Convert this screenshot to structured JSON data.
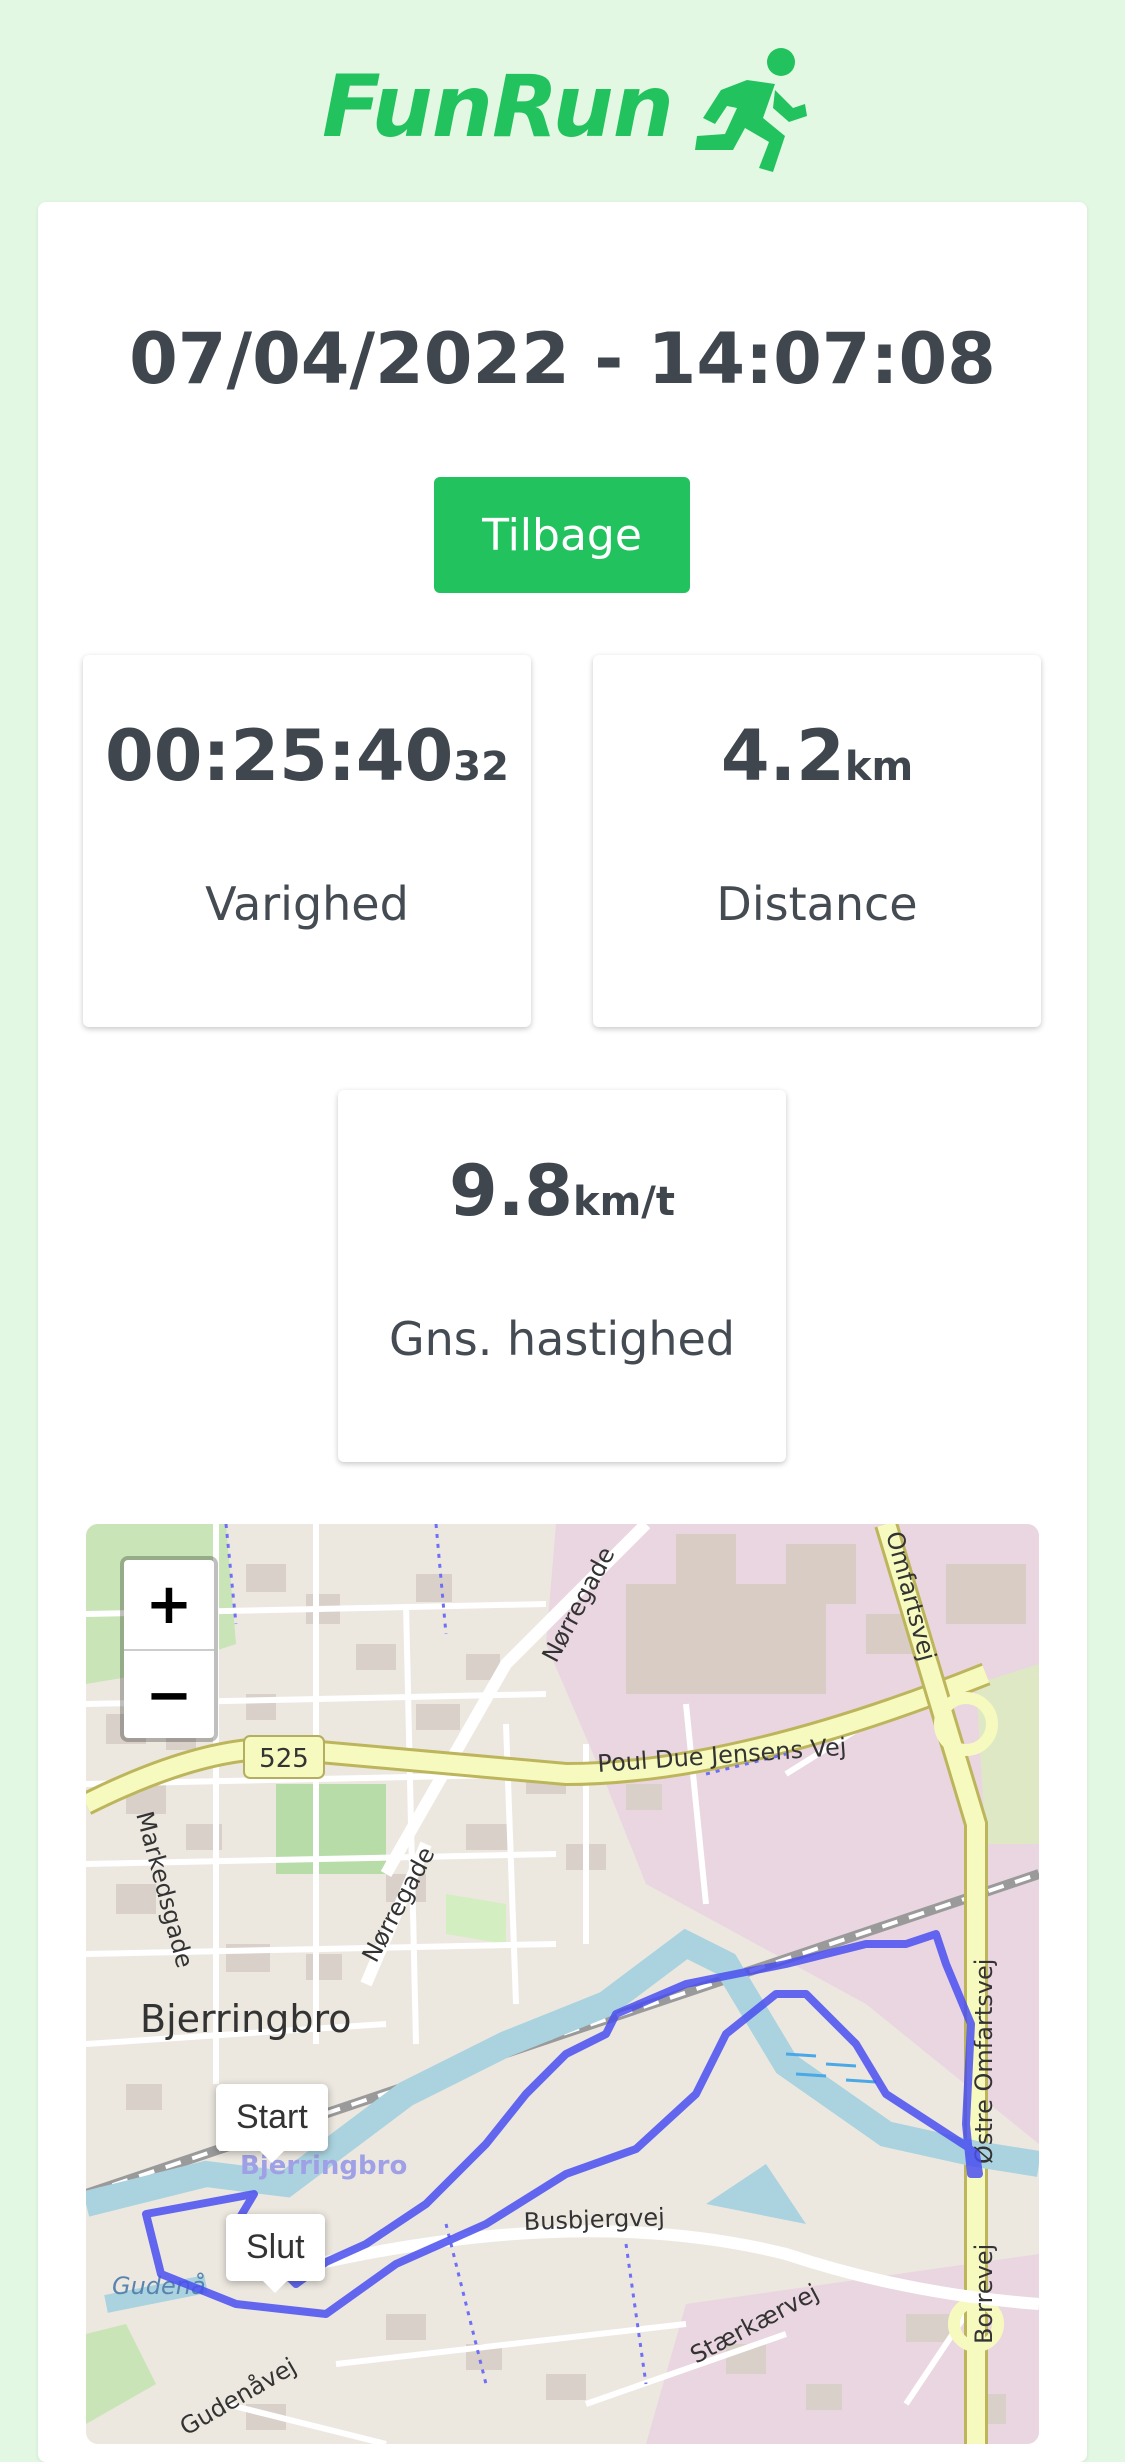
{
  "app": {
    "name": "FunRun",
    "logo_icon": "runner-icon"
  },
  "run": {
    "datetime": "07/04/2022 - 14:07:08"
  },
  "back_button": {
    "label": "Tilbage"
  },
  "stats": {
    "duration": {
      "value": "00:25:40",
      "sub": "32",
      "label": "Varighed"
    },
    "distance": {
      "value": "4.2",
      "unit": "km",
      "label": "Distance"
    },
    "speed": {
      "value": "9.8",
      "unit": "km/t",
      "label": "Gns. hastighed"
    }
  },
  "map": {
    "zoom_in": "+",
    "zoom_out": "−",
    "labels": {
      "town": "Bjerringbro",
      "town_faint": "Bjerringbro",
      "road_525": "525",
      "poul_due": "Poul Due Jensens Vej",
      "norregade1": "Nørregade",
      "norregade2": "Nørregade",
      "markedsgade": "Markedsgade",
      "omfartsvej_top": "Omfartsvej",
      "ostre_omfartsvej": "Østre Omfartsvej",
      "borrevej": "Borrevej",
      "busbjergvej": "Busbjergvej",
      "gudenaavej": "Gudenåvej",
      "staerkaervej": "Stærkærvej",
      "gudenaa": "Gudenå"
    },
    "markers": {
      "start": "Start",
      "end": "Slut"
    },
    "colors": {
      "route": "#4a4ff0",
      "river": "#aad3df"
    }
  },
  "colors": {
    "accent": "#22c35e",
    "background": "#e2f8e2",
    "text": "#3f464d"
  }
}
